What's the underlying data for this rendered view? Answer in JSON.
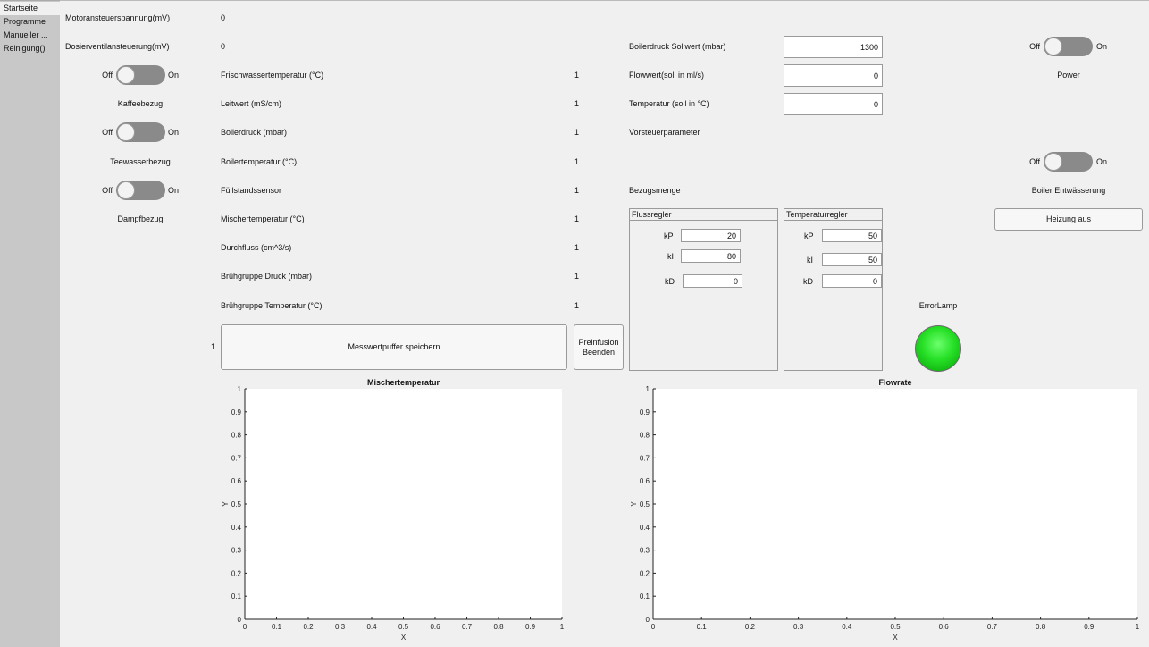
{
  "sidebar": {
    "tabs": [
      {
        "label": "Startseite",
        "active": true
      },
      {
        "label": "Programme",
        "active": false
      },
      {
        "label": "Manueller ...",
        "active": false
      },
      {
        "label": "Reinigung()",
        "active": false
      }
    ]
  },
  "left": {
    "motor_label": "Motoransteuerspannung(mV)",
    "motor_value": "0",
    "dosier_label": "Dosierventilansteuerung(mV)",
    "dosier_value": "0",
    "switch_off": "Off",
    "switch_on": "On",
    "kaffee_label": "Kaffeebezug",
    "tee_label": "Teewasserbezug",
    "dampf_label": "Dampfbezug"
  },
  "sensors": [
    {
      "label": "Frischwassertemperatur (°C)",
      "value": "1"
    },
    {
      "label": "Leitwert (mS/cm)",
      "value": "1"
    },
    {
      "label": "Boilerdruck (mbar)",
      "value": "1"
    },
    {
      "label": "Boilertemperatur (°C)",
      "value": "1"
    },
    {
      "label": "Füllstandssensor",
      "value": "1"
    },
    {
      "label": "Mischertemperatur (°C)",
      "value": "1"
    },
    {
      "label": "Durchfluss (cm^3/s)",
      "value": "1"
    },
    {
      "label": "Brühgruppe Druck (mbar)",
      "value": "1"
    },
    {
      "label": "Brühgruppe Temperatur (°C)",
      "value": "1"
    }
  ],
  "buffer": {
    "count": "1",
    "save_label": "Messwertpuffer speichern",
    "preinfusion_label": "Preinfusion Beenden"
  },
  "setpoints": {
    "boilerdruck_label": "Boilerdruck Sollwert (mbar)",
    "boilerdruck_value": "1300",
    "flow_label": "Flowwert(soll in ml/s)",
    "flow_value": "0",
    "temp_label": "Temperatur (soll in °C)",
    "temp_value": "0",
    "vorsteuer_label": "Vorsteuerparameter",
    "bezug_label": "Bezugsmenge"
  },
  "flussregler": {
    "title": "Flussregler",
    "kp_label": "kP",
    "kp": "20",
    "ki_label": "kI",
    "ki": "80",
    "kd_label": "kD",
    "kd": "0"
  },
  "temperaturregler": {
    "title": "Temperaturregler",
    "kp_label": "kP",
    "kp": "50",
    "ki_label": "kI",
    "ki": "50",
    "kd_label": "kD",
    "kd": "0"
  },
  "right": {
    "power_label": "Power",
    "entwaesserung_label": "Boiler Entwässerung",
    "heizung_label": "Heizung  aus",
    "error_label": "ErrorLamp",
    "lamp_color": "#22dd22"
  },
  "chart_data": [
    {
      "type": "line",
      "title": "Mischertemperatur",
      "xlabel": "X",
      "ylabel": "Y",
      "xlim": [
        0,
        1
      ],
      "ylim": [
        0,
        1
      ],
      "xticks": [
        "0",
        "0.1",
        "0.2",
        "0.3",
        "0.4",
        "0.5",
        "0.6",
        "0.7",
        "0.8",
        "0.9",
        "1"
      ],
      "yticks": [
        "0",
        "0.1",
        "0.2",
        "0.3",
        "0.4",
        "0.5",
        "0.6",
        "0.7",
        "0.8",
        "0.9",
        "1"
      ],
      "series": []
    },
    {
      "type": "line",
      "title": "Flowrate",
      "xlabel": "X",
      "ylabel": "Y",
      "xlim": [
        0,
        1
      ],
      "ylim": [
        0,
        1
      ],
      "xticks": [
        "0",
        "0.1",
        "0.2",
        "0.3",
        "0.4",
        "0.5",
        "0.6",
        "0.7",
        "0.8",
        "0.9",
        "1"
      ],
      "yticks": [
        "0",
        "0.1",
        "0.2",
        "0.3",
        "0.4",
        "0.5",
        "0.6",
        "0.7",
        "0.8",
        "0.9",
        "1"
      ],
      "series": []
    }
  ]
}
